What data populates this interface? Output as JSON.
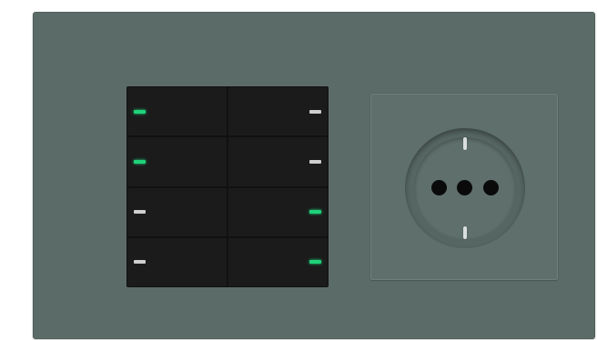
{
  "colors": {
    "plate": "#5b6b68",
    "plate_edge": "#4f5e5b",
    "socket_plate": "#5f6f6c",
    "socket_plate_edge": "#6f7f7c",
    "socket_well": "#566663",
    "socket_inner": "#5f6f6c",
    "keypad_frame": "#111111",
    "key": "#1b1b1b",
    "led_on": "#1fd27a",
    "led_off": "#cfcfcf",
    "hole": "#0a0a0a",
    "clip": "#d9dedd"
  },
  "keypad": {
    "keys": [
      {
        "name": "key-row1-left",
        "side": "left",
        "led": "on"
      },
      {
        "name": "key-row1-right",
        "side": "right",
        "led": "off"
      },
      {
        "name": "key-row2-left",
        "side": "left",
        "led": "on"
      },
      {
        "name": "key-row2-right",
        "side": "right",
        "led": "off"
      },
      {
        "name": "key-row3-left",
        "side": "left",
        "led": "off"
      },
      {
        "name": "key-row3-right",
        "side": "right",
        "led": "on"
      },
      {
        "name": "key-row4-left",
        "side": "left",
        "led": "off"
      },
      {
        "name": "key-row4-right",
        "side": "right",
        "led": "on"
      }
    ]
  },
  "socket": {
    "holes": 3,
    "earth_clips": 2
  }
}
